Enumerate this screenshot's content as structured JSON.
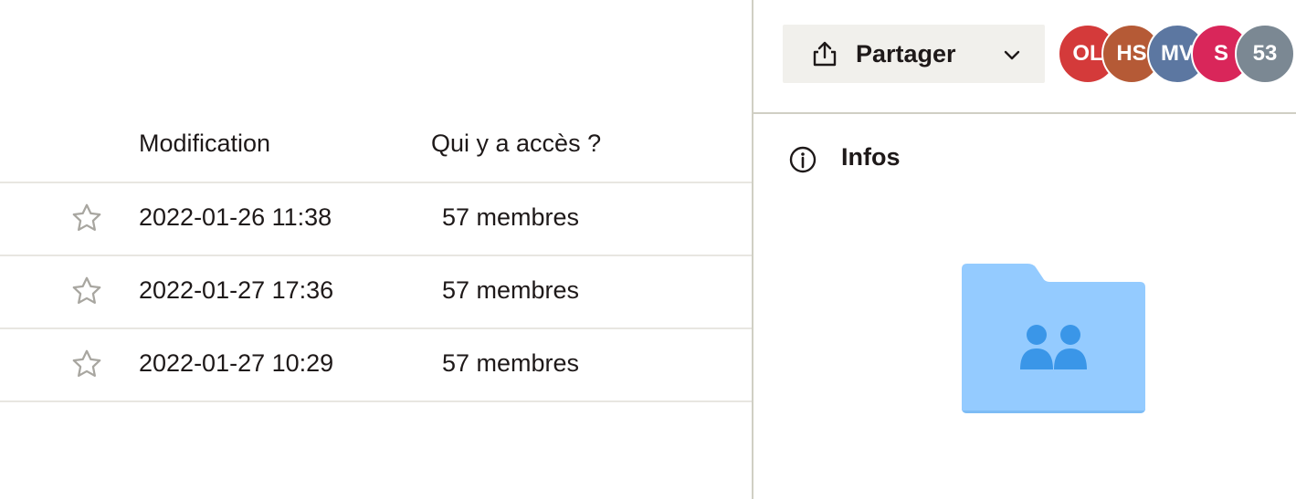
{
  "table": {
    "headers": {
      "modification": "Modification",
      "access": "Qui y a accès ?"
    },
    "rows": [
      {
        "date": "2022-01-26 11:38",
        "access": "57 membres",
        "starred": false
      },
      {
        "date": "2022-01-27 17:36",
        "access": "57 membres",
        "starred": false
      },
      {
        "date": "2022-01-27 10:29",
        "access": "57 membres",
        "starred": false
      }
    ]
  },
  "toolbar": {
    "share_label": "Partager",
    "share_icon": "share-upload-icon",
    "dropdown_icon": "chevron-down-icon"
  },
  "avatars": [
    {
      "initials": "OL",
      "color": "#d43a3a"
    },
    {
      "initials": "HS",
      "color": "#b55a36"
    },
    {
      "initials": "MV",
      "color": "#5c77a1"
    },
    {
      "initials": "S",
      "color": "#d9265a"
    },
    {
      "initials": "53",
      "color": "#7b8893"
    }
  ],
  "info_panel": {
    "title": "Infos",
    "icon": "info-icon",
    "folder_icon": "shared-folder-icon",
    "folder_color": "#94cbff",
    "folder_people_color": "#3a96e8"
  }
}
